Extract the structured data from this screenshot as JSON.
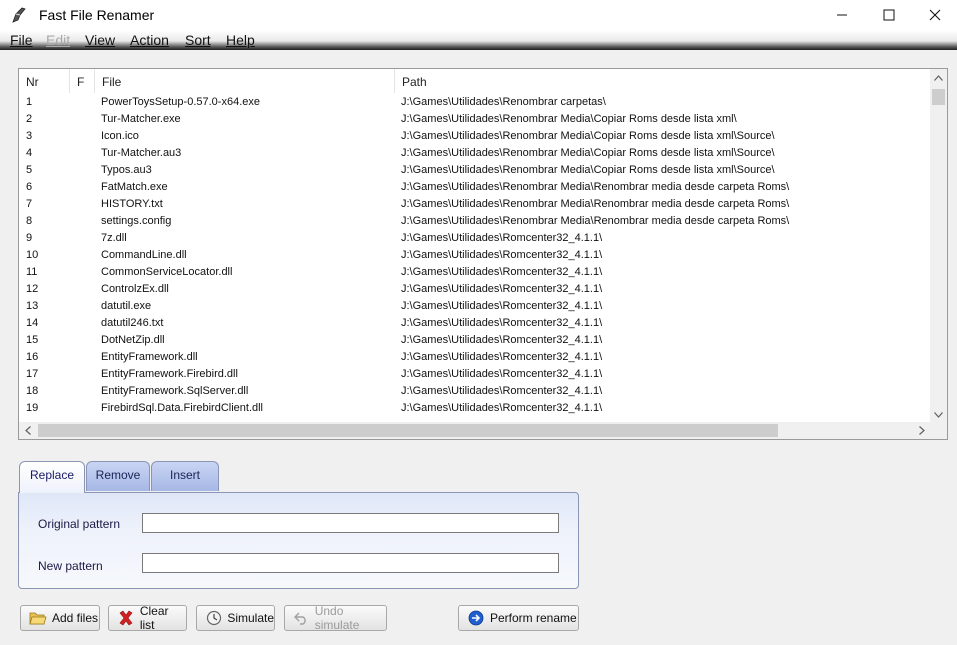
{
  "window": {
    "title": "Fast File Renamer",
    "controls": {
      "minimize": "─",
      "maximize": "☐",
      "close": "✕"
    }
  },
  "menu": {
    "items": [
      {
        "label": "File",
        "enabled": true
      },
      {
        "label": "Edit",
        "enabled": false
      },
      {
        "label": "View",
        "enabled": true
      },
      {
        "label": "Action",
        "enabled": true
      },
      {
        "label": "Sort",
        "enabled": true
      },
      {
        "label": "Help",
        "enabled": true
      }
    ]
  },
  "list": {
    "columns": {
      "nr": "Nr",
      "flag": "F",
      "file": "File",
      "path": "Path"
    },
    "rows": [
      {
        "nr": "1",
        "file": "PowerToysSetup-0.57.0-x64.exe",
        "path": "J:\\Games\\Utilidades\\Renombrar carpetas\\"
      },
      {
        "nr": "2",
        "file": "Tur-Matcher.exe",
        "path": "J:\\Games\\Utilidades\\Renombrar Media\\Copiar Roms desde lista xml\\"
      },
      {
        "nr": "3",
        "file": "Icon.ico",
        "path": "J:\\Games\\Utilidades\\Renombrar Media\\Copiar Roms desde lista xml\\Source\\"
      },
      {
        "nr": "4",
        "file": "Tur-Matcher.au3",
        "path": "J:\\Games\\Utilidades\\Renombrar Media\\Copiar Roms desde lista xml\\Source\\"
      },
      {
        "nr": "5",
        "file": "Typos.au3",
        "path": "J:\\Games\\Utilidades\\Renombrar Media\\Copiar Roms desde lista xml\\Source\\"
      },
      {
        "nr": "6",
        "file": "FatMatch.exe",
        "path": "J:\\Games\\Utilidades\\Renombrar Media\\Renombrar media desde carpeta Roms\\"
      },
      {
        "nr": "7",
        "file": "HISTORY.txt",
        "path": "J:\\Games\\Utilidades\\Renombrar Media\\Renombrar media desde carpeta Roms\\"
      },
      {
        "nr": "8",
        "file": "settings.config",
        "path": "J:\\Games\\Utilidades\\Renombrar Media\\Renombrar media desde carpeta Roms\\"
      },
      {
        "nr": "9",
        "file": "7z.dll",
        "path": "J:\\Games\\Utilidades\\Romcenter32_4.1.1\\"
      },
      {
        "nr": "10",
        "file": "CommandLine.dll",
        "path": "J:\\Games\\Utilidades\\Romcenter32_4.1.1\\"
      },
      {
        "nr": "11",
        "file": "CommonServiceLocator.dll",
        "path": "J:\\Games\\Utilidades\\Romcenter32_4.1.1\\"
      },
      {
        "nr": "12",
        "file": "ControlzEx.dll",
        "path": "J:\\Games\\Utilidades\\Romcenter32_4.1.1\\"
      },
      {
        "nr": "13",
        "file": "datutil.exe",
        "path": "J:\\Games\\Utilidades\\Romcenter32_4.1.1\\"
      },
      {
        "nr": "14",
        "file": "datutil246.txt",
        "path": "J:\\Games\\Utilidades\\Romcenter32_4.1.1\\"
      },
      {
        "nr": "15",
        "file": "DotNetZip.dll",
        "path": "J:\\Games\\Utilidades\\Romcenter32_4.1.1\\"
      },
      {
        "nr": "16",
        "file": "EntityFramework.dll",
        "path": "J:\\Games\\Utilidades\\Romcenter32_4.1.1\\"
      },
      {
        "nr": "17",
        "file": "EntityFramework.Firebird.dll",
        "path": "J:\\Games\\Utilidades\\Romcenter32_4.1.1\\"
      },
      {
        "nr": "18",
        "file": "EntityFramework.SqlServer.dll",
        "path": "J:\\Games\\Utilidades\\Romcenter32_4.1.1\\"
      },
      {
        "nr": "19",
        "file": "FirebirdSql.Data.FirebirdClient.dll",
        "path": "J:\\Games\\Utilidades\\Romcenter32_4.1.1\\"
      }
    ],
    "scroll": {
      "up": "▲",
      "down": "▼",
      "left": "◀",
      "right": "▶"
    }
  },
  "tabs": [
    {
      "label": "Replace",
      "active": true
    },
    {
      "label": "Remove",
      "active": false
    },
    {
      "label": "Insert",
      "active": false
    }
  ],
  "replace_panel": {
    "original_label": "Original pattern",
    "original_value": "",
    "new_label": "New pattern",
    "new_value": ""
  },
  "buttons": {
    "add_files": "Add files",
    "clear_list": "Clear list",
    "simulate": "Simulate",
    "undo_simulate": "Undo simulate",
    "perform_rename": "Perform rename"
  },
  "icons": {
    "app": "feather-quill-icon",
    "add_files": "folder-open-icon",
    "clear_list": "red-x-icon",
    "simulate": "clock-icon",
    "undo_simulate": "undo-arrow-icon",
    "perform_rename": "blue-arrow-circle-icon"
  },
  "colors": {
    "tab_active_text": "#1a1a66",
    "tab_inactive_bg": "#b5c5ec",
    "panel_border": "#8a96b4",
    "clear_icon": "#d42020",
    "rename_icon": "#1f5fcf"
  }
}
